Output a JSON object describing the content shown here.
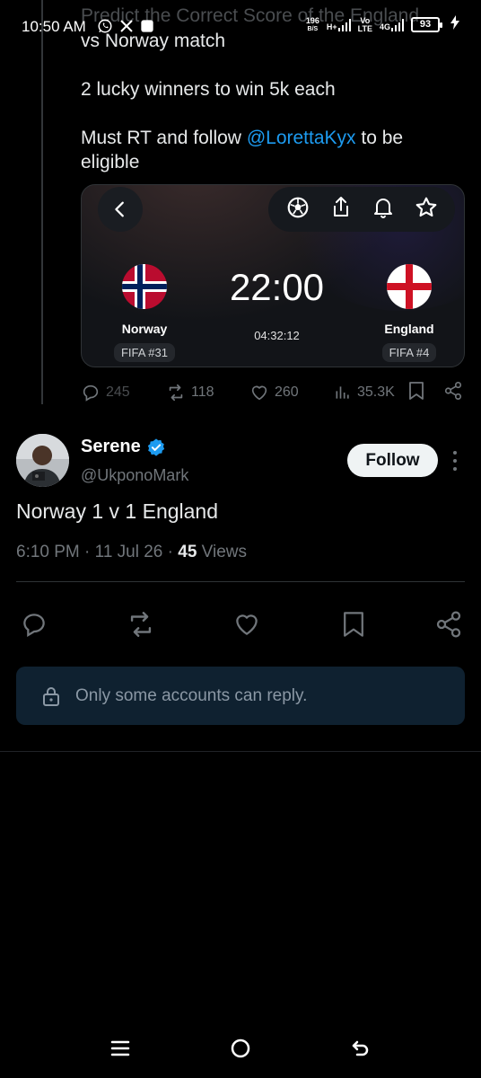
{
  "status_bar": {
    "time": "10:50 AM",
    "net_speed_value": "196",
    "net_speed_unit": "B/S",
    "network_1": "H+",
    "network_2_top": "Vo",
    "network_2_bottom": "LTE",
    "network_3": "4G",
    "battery": "93",
    "icons": [
      "whatsapp-icon",
      "x-icon",
      "square-icon",
      "signal-icon",
      "charging-icon"
    ]
  },
  "quoted_post": {
    "faded_line": "Predict the Correct Score of the England",
    "lines": [
      "vs Norway match",
      "",
      "2 lucky winners to win 5k each",
      "",
      "Must RT and follow"
    ],
    "mention": "@LorettaKyx",
    "after_mention": " to be",
    "last_line": "eligible",
    "card": {
      "home_team": "Norway",
      "home_rank": "FIFA #31",
      "away_team": "England",
      "away_rank": "FIFA #4",
      "kickoff": "22:00",
      "countdown": "04:32:12"
    },
    "stats": {
      "replies": "245",
      "reposts": "118",
      "likes": "260",
      "views": "35.3K"
    }
  },
  "post": {
    "display_name": "Serene",
    "handle": "@UkponoMark",
    "follow_label": "Follow",
    "text": "Norway 1 v 1 England",
    "time": "6:10 PM",
    "date": "11 Jul 26",
    "views_count": "45",
    "views_label": "Views",
    "verified_color": "#1d9bf0"
  },
  "reply_restriction": "Only some accounts can reply.",
  "colors": {
    "accent": "#1d9bf0",
    "muted": "#71767b",
    "background": "#000000"
  }
}
